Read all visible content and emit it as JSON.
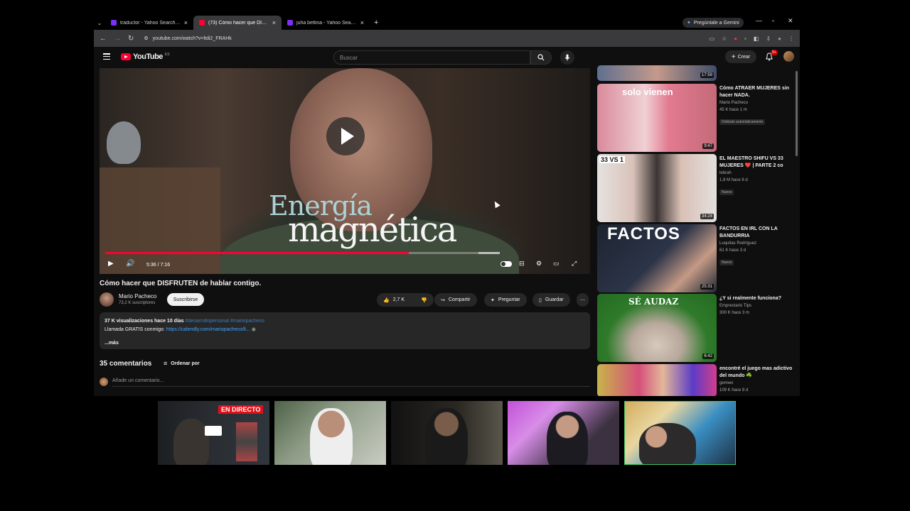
{
  "browser": {
    "tabs": [
      {
        "title": "traductor - Yahoo Search Fus",
        "color": "#7b2ff7"
      },
      {
        "title": "(73) Cómo hacer que DISFRU",
        "color": "#ff0033"
      },
      {
        "title": "juha bettina - Yahoo Search",
        "color": "#7b2ff7"
      }
    ],
    "gemini_label": "Pregúntale a Gemini",
    "url": "youtube.com/watch?v=ltdi2_FRAHk"
  },
  "header": {
    "logo_text": "YouTube",
    "logo_suffix": "ES",
    "search_placeholder": "Buscar",
    "create_label": "Crear",
    "notif_count": "9+"
  },
  "player": {
    "overlay_line1": "Energía",
    "overlay_line2": "magnética",
    "time": "5:36 / 7:16",
    "progress_fraction": 0.77
  },
  "video": {
    "title": "Cómo hacer que DISFRUTEN de hablar contigo.",
    "channel": "Mario Pacheco",
    "subs": "73,2 K suscriptores",
    "subscribe_label": "Suscribirse",
    "likes": "2,7 K",
    "share_label": "Compartir",
    "ask_label": "Preguntar",
    "save_label": "Guardar",
    "desc_stats": "37 K visualizaciones  hace 10 días",
    "desc_tags": "#desarrollopersonal #mariopacheco",
    "desc_line2_prefix": "Llamada GRATIS conmigo:",
    "desc_link": "https://calendly.com/mariopacheco/li...",
    "more_label": "...más"
  },
  "comments": {
    "count_label": "35 comentarios",
    "sort_label": "Ordenar por",
    "add_placeholder": "Añade un comentario..."
  },
  "sidebar": {
    "top_duration": "17:59",
    "items": [
      {
        "title": "Cómo ATRAER MUJERES sin hacer NADA.",
        "channel": "Mario Pacheco",
        "meta": "45 K  hace 1 m",
        "tag": "Doblado automáticamente",
        "duration": "9:47",
        "thumb_text": "solo vienen"
      },
      {
        "title": "EL MAESTRO SHIFU VS 33 MUJERES ❤️ | PARTE 2 co",
        "channel": "lebrah",
        "meta": "1,8 M  hace 6 d",
        "tag": "Nuevo",
        "duration": "34:24",
        "thumb_text": "33 VS 1"
      },
      {
        "title": "FACTOS EN IRL CON LA BANDURRIA",
        "channel": "Luquitas Rodríguez",
        "meta": "61 K  hace 3 d",
        "tag": "Nuevo",
        "duration": "25:31",
        "thumb_text": "FACTOS"
      },
      {
        "title": "¿Y si realmente funciona?",
        "channel": "Emprestario Tips",
        "meta": "300 K  hace 3 m",
        "tag": "",
        "duration": "6:42",
        "thumb_text": "SÉ AUDAZ"
      },
      {
        "title": "encontré el juego mas adictivo del mundo ☘️",
        "channel": "gemwo",
        "meta": "109 K  hace 8 d",
        "tag": "",
        "duration": "",
        "thumb_text": ""
      }
    ]
  },
  "webcams": {
    "live_label": "EN DIRECTO"
  }
}
